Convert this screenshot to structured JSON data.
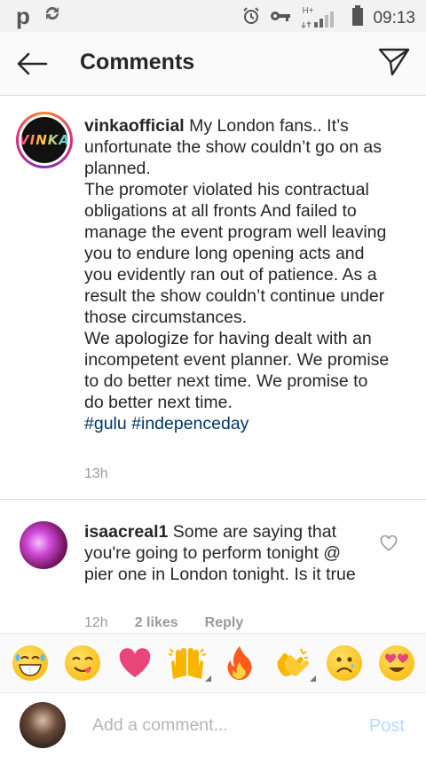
{
  "status_bar": {
    "carrier_letter": "p",
    "time": "09:13",
    "network_label": "H+"
  },
  "header": {
    "title": "Comments"
  },
  "caption": {
    "username": "vinkaofficial",
    "avatar_logo_text": "VINKA",
    "text_part1": " My London fans.. It’s unfortunate the show couldn’t go on as planned.",
    "text_part2": "The promoter violated his contractual obligations at all fronts And failed to manage the event program well leaving you to endure long opening acts and you evidently ran out of patience. As a result the show couldn’t continue under those circumstances.",
    "text_part3": "We apologize for having dealt with an incompetent event planner. We promise to do better next time. We promise to do better next time.",
    "hashtag1": "#gulu",
    "hashtag2": "#indepenceday",
    "time_ago": "13h"
  },
  "comment": {
    "username": "isaacreal1",
    "text": " Some are saying that you're going to perform tonight @ pier one in London tonight. Is it true",
    "time_ago": "12h",
    "likes": "2 likes",
    "reply_label": "Reply"
  },
  "emoji_bar": [
    {
      "name": "grinning-sweat",
      "glyph": "😁",
      "color": "#f7b500"
    },
    {
      "name": "yum",
      "glyph": "😋",
      "color": "#f7b500"
    },
    {
      "name": "heart",
      "glyph": "❤",
      "color": "#e8457a"
    },
    {
      "name": "raised-hands",
      "glyph": "🙌",
      "color": "#f7b500"
    },
    {
      "name": "fire",
      "glyph": "🔥",
      "color": "#ff5a1f"
    },
    {
      "name": "clapping-hands",
      "glyph": "👏",
      "color": "#f7b500"
    },
    {
      "name": "sad",
      "glyph": "☹",
      "color": "#f7b500"
    },
    {
      "name": "heart-eyes",
      "glyph": "😍",
      "color": "#f7b500"
    }
  ],
  "input": {
    "placeholder": "Add a comment...",
    "post_label": "Post"
  },
  "colors": {
    "hashtag": "#003569",
    "post_disabled": "#b3dbff",
    "meta_gray": "#999999"
  }
}
